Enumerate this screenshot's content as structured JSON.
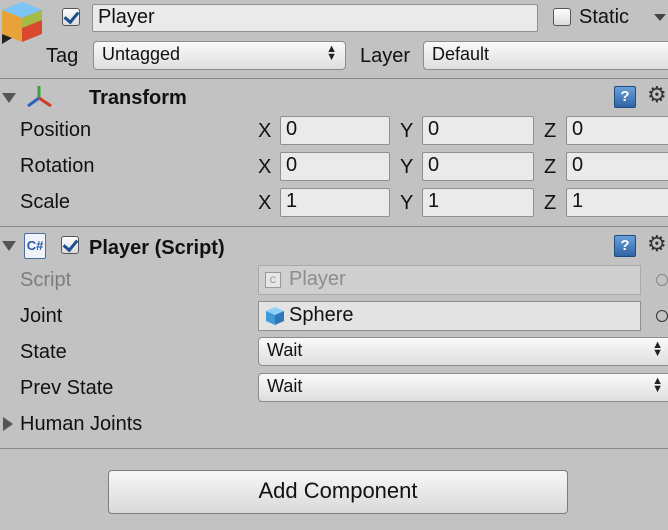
{
  "header": {
    "active_checked": true,
    "name": "Player",
    "static_label": "Static",
    "static_checked": false,
    "tag_label": "Tag",
    "tag_value": "Untagged",
    "layer_label": "Layer",
    "layer_value": "Default"
  },
  "transform": {
    "title": "Transform",
    "rows": [
      {
        "label": "Position",
        "x": "0",
        "y": "0",
        "z": "0"
      },
      {
        "label": "Rotation",
        "x": "0",
        "y": "0",
        "z": "0"
      },
      {
        "label": "Scale",
        "x": "1",
        "y": "1",
        "z": "1"
      }
    ],
    "axis_x": "X",
    "axis_y": "Y",
    "axis_z": "Z"
  },
  "script_component": {
    "title": "Player (Script)",
    "enabled": true,
    "fields": {
      "script": {
        "label": "Script",
        "value": "Player"
      },
      "joint": {
        "label": "Joint",
        "value": "Sphere"
      },
      "state": {
        "label": "State",
        "value": "Wait"
      },
      "prev_state": {
        "label": "Prev State",
        "value": "Wait"
      },
      "human_joints": {
        "label": "Human Joints"
      }
    }
  },
  "add_component": {
    "label": "Add Component"
  },
  "icons": {
    "gameobject": "gameobject-cube-icon",
    "transform": "transform-axes-icon",
    "script": "csharp-script-icon",
    "help": "help-book-icon",
    "settings": "gear-icon",
    "mesh": "mesh-cube-icon",
    "object_picker": "object-picker-icon"
  },
  "colors": {
    "background": "#c2c2c2",
    "help_blue": "#3b74b8"
  }
}
